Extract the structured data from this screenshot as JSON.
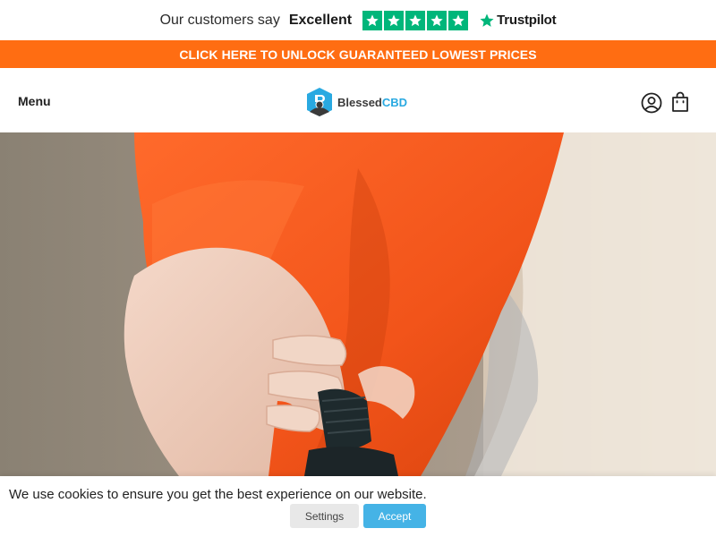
{
  "trustpilot": {
    "prefix": "Our customers say",
    "rating_word": "Excellent",
    "stars": 5,
    "brand": "Trustpilot",
    "star_color": "#00b67a"
  },
  "promo": {
    "text": "CLICK HERE TO UNLOCK GUARANTEED LOWEST PRICES",
    "background": "#ff6d12"
  },
  "header": {
    "menu_label": "Menu",
    "logo_text_primary": "Blessed",
    "logo_text_accent": "CBD",
    "logo_accent_color": "#29a9e1",
    "icons": [
      "account-icon",
      "cart-icon"
    ]
  },
  "hero": {
    "image": "hand-holding-dropper-bottle-photo"
  },
  "cookie": {
    "message": "We use cookies to ensure you get the best experience on our website.",
    "settings_label": "Settings",
    "accept_label": "Accept",
    "accept_color": "#45b3e6"
  }
}
